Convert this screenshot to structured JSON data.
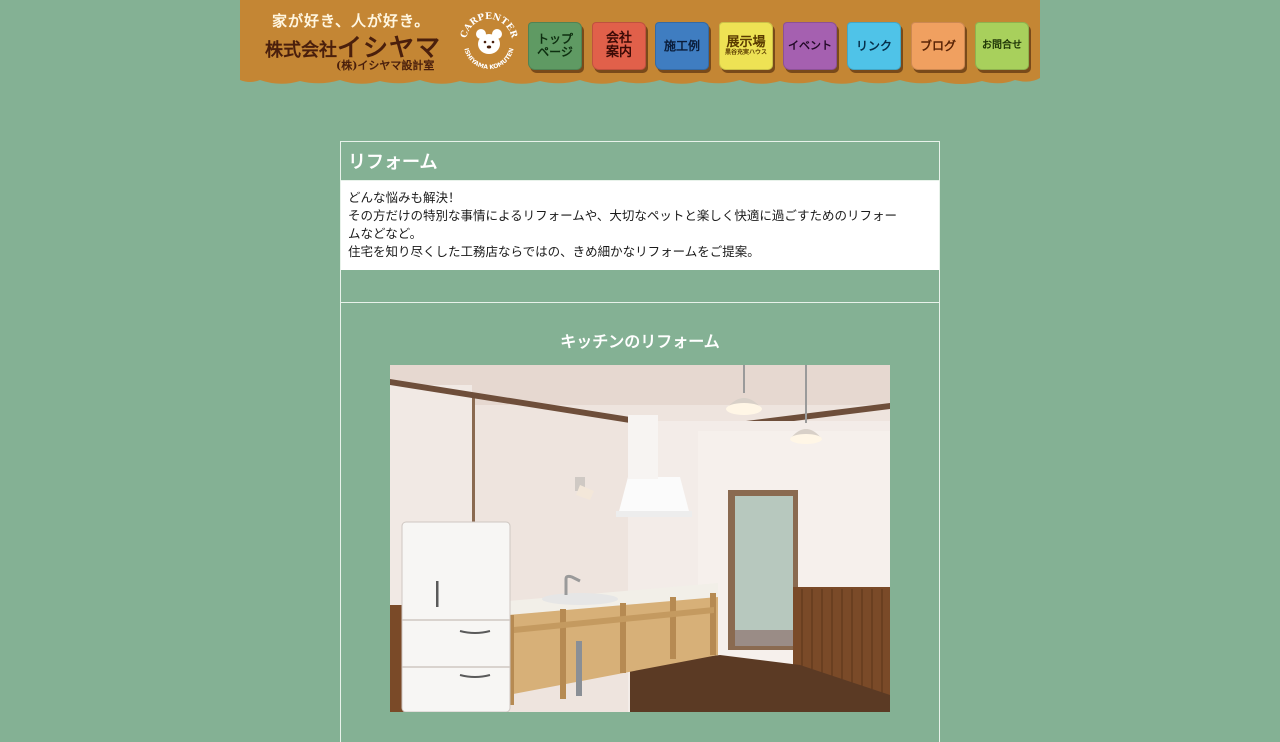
{
  "header": {
    "tagline": "家が好き、人が好き。",
    "company_prefix": "株式会社",
    "company_name": "イシヤマ",
    "company_sub": "(株)イシヤマ設計室",
    "badge_top": "CARPENTER",
    "badge_bottom": "ISHIYAMA KOMUTEN"
  },
  "nav": [
    {
      "line1": "トップ",
      "line2": "ページ",
      "bg": "#5f9a63",
      "fg": "#0e2f10"
    },
    {
      "line1": "会社",
      "line2": "案内",
      "bg": "#e1604a",
      "fg": "#3b0a06"
    },
    {
      "line1": "施工例",
      "line2": "",
      "bg": "#3f7dc1",
      "fg": "#0a1d3a"
    },
    {
      "line1": "展示場",
      "line2": "黒谷充実ハウス",
      "bg": "#eee254",
      "fg": "#5a3a00"
    },
    {
      "line1": "イベント",
      "line2": "",
      "bg": "#a560b0",
      "fg": "#230a28"
    },
    {
      "line1": "リンク",
      "line2": "",
      "bg": "#4fc3e8",
      "fg": "#06304a"
    },
    {
      "line1": "ブログ",
      "line2": "",
      "bg": "#f0a060",
      "fg": "#5a2406"
    },
    {
      "line1": "お問合せ",
      "line2": "",
      "bg": "#a8d05c",
      "fg": "#1f3606"
    }
  ],
  "content": {
    "title": "リフォーム",
    "intro_lines": [
      "どんな悩みも解決！",
      "その方だけの特別な事情によるリフォームや、大切なペットと楽しく快適に過ごすためのリフォー",
      "ムなどなど。",
      "住宅を知り尽くした工務店ならではの、きめ細かなリフォームをご提案。"
    ],
    "section_title": "キッチンのリフォーム"
  },
  "colors": {
    "background": "#84b194",
    "header": "#c48634",
    "header_text_dark": "#4a1f0c"
  }
}
